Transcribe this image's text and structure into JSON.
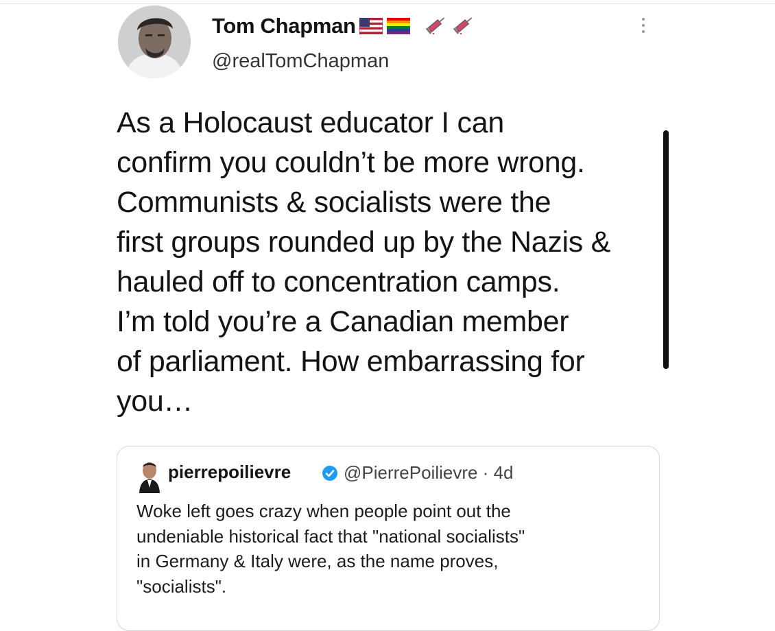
{
  "tweet": {
    "author": {
      "display_name": "Tom Chapman",
      "handle": "@realTomChapman",
      "name_badges": [
        "us-flag-icon",
        "rainbow-flag-icon",
        "syringe-icon",
        "syringe-icon"
      ]
    },
    "text": "As a Holocaust educator I can\nconfirm you couldn’t be more wrong.\nCommunists & socialists were the\nfirst groups rounded up by the Nazis &\nhauled off to concentration camps.\nI’m told you’re a Canadian member\nof parliament. How embarrassing for\nyou…",
    "more_icon": "more-vertical-icon"
  },
  "quoted_tweet": {
    "display_name": "pierrepoilievre",
    "verified": true,
    "handle_and_time": "@PierrePoilievre · 4d",
    "text": "Woke left goes crazy when people point out the\nundeniable historical fact that \"national socialists\"\nin Germany & Italy were, as the name proves,\n\"socialists\"."
  },
  "colors": {
    "text": "#141414",
    "secondary_text": "#444444",
    "verified_badge": "#1d9bf0",
    "border": "#d6d6d6"
  }
}
